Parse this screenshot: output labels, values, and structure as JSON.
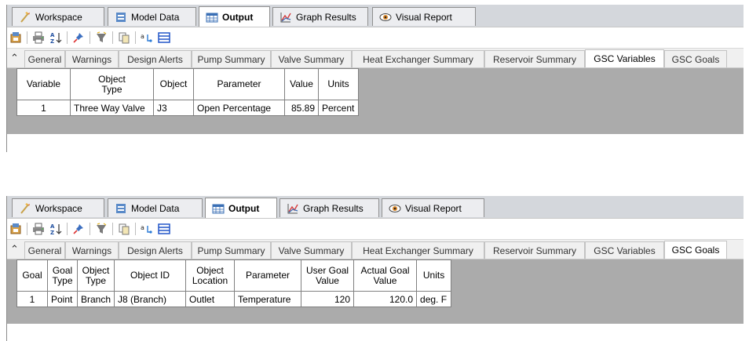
{
  "colors": {
    "app_bg": "#ababab",
    "tab_active": "#ffffff",
    "tab_inactive": "#ecedf0"
  },
  "top_tabs": [
    {
      "label": "Workspace",
      "icon": "workspace-icon"
    },
    {
      "label": "Model Data",
      "icon": "model-data-icon"
    },
    {
      "label": "Output",
      "icon": "output-table-icon",
      "active": true
    },
    {
      "label": "Graph Results",
      "icon": "graph-icon"
    },
    {
      "label": "Visual Report",
      "icon": "eye-icon"
    }
  ],
  "toolbar_icons": [
    "output-control-icon",
    "print-icon",
    "sort-icon",
    "pin-icon",
    "filter-icon",
    "copy-icon",
    "find-icon",
    "table-view-icon"
  ],
  "sub_tabs": [
    "General",
    "Warnings",
    "Design Alerts",
    "Pump Summary",
    "Valve Summary",
    "Heat Exchanger Summary",
    "Reservoir Summary",
    "GSC Variables",
    "GSC Goals"
  ],
  "panel1": {
    "active_tab": "GSC Variables",
    "headers": {
      "col1": "Variable",
      "col2a": "Object",
      "col2b": "Type",
      "col3": "Object",
      "col4": "Parameter",
      "col5": "Value",
      "col6": "Units"
    },
    "row": {
      "variable": "1",
      "object_type": "Three Way Valve",
      "object": "J3",
      "parameter": "Open Percentage",
      "value": "85.89",
      "units": "Percent"
    }
  },
  "panel2": {
    "active_tab": "GSC Goals",
    "headers": {
      "goal": "Goal",
      "goal_type_a": "Goal",
      "goal_type_b": "Type",
      "object_type_a": "Object",
      "object_type_b": "Type",
      "object_id": "Object ID",
      "object_location_a": "Object",
      "object_location_b": "Location",
      "parameter": "Parameter",
      "user_goal_a": "User Goal",
      "user_goal_b": "Value",
      "actual_goal_a": "Actual Goal",
      "actual_goal_b": "Value",
      "units": "Units"
    },
    "row": {
      "goal": "1",
      "goal_type": "Point",
      "object_type": "Branch",
      "object_id": "J8 (Branch)",
      "object_location": "Outlet",
      "parameter": "Temperature",
      "user_goal": "120",
      "actual_goal": "120.0",
      "units": "deg. F"
    }
  }
}
